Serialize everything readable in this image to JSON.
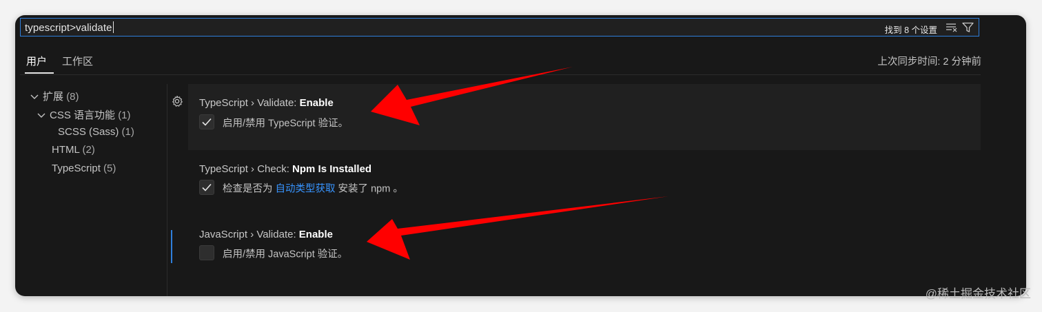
{
  "search": {
    "value": "typescript>validate",
    "result_count": "找到 8 个设置",
    "icons": [
      "clear-filter-icon",
      "filter-icon"
    ]
  },
  "tabs": {
    "user": "用户",
    "workspace": "工作区",
    "sync_status": "上次同步时间: 2 分钟前"
  },
  "toc": {
    "items": [
      {
        "label": "扩展",
        "count": "(8)",
        "expanded": true
      },
      {
        "label": "CSS 语言功能",
        "count": "(1)",
        "expanded": true
      },
      {
        "label": "SCSS (Sass)",
        "count": "(1)"
      },
      {
        "label": "HTML",
        "count": "(2)"
      },
      {
        "label": "TypeScript",
        "count": "(5)"
      }
    ]
  },
  "settings": [
    {
      "category": "TypeScript › Validate: ",
      "key": "Enable",
      "checked": true,
      "description": "启用/禁用 TypeScript 验证。"
    },
    {
      "category": "TypeScript › Check: ",
      "key": "Npm Is Installed",
      "checked": true,
      "description_before": "检查是否为 ",
      "link": "自动类型获取",
      "description_after": " 安装了 npm 。"
    },
    {
      "category": "JavaScript › Validate: ",
      "key": "Enable",
      "checked": false,
      "description": "启用/禁用 JavaScript 验证。"
    }
  ],
  "colors": {
    "background": "#181818",
    "focus_border": "#2f7fdc",
    "link": "#3794ff",
    "annotation_arrow": "#ff0000"
  },
  "watermark": "@稀土掘金技术社区"
}
